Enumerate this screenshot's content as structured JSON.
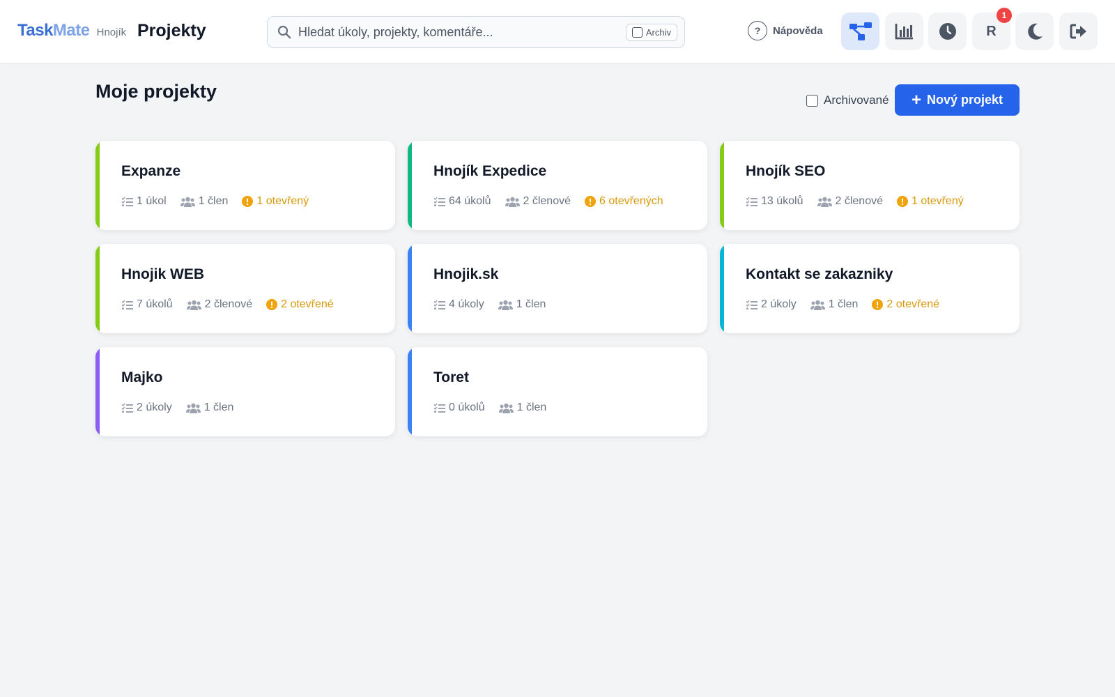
{
  "header": {
    "logo_part1": "Task",
    "logo_part2": "Mate",
    "workspace": "Hnojík",
    "title": "Projekty",
    "search_placeholder": "Hledat úkoly, projekty, komentáře...",
    "archive_chip": "Archiv",
    "help_label": "Nápověda",
    "help_icon_glyph": "?",
    "avatar_letter": "R",
    "notification_count": "1",
    "icons": [
      "project-tree-icon",
      "chart-bar-icon",
      "clock-icon",
      "avatar",
      "moon-icon",
      "logout-icon"
    ]
  },
  "main": {
    "section_title": "Moje projekty",
    "archived_label": "Archivované",
    "new_project_label": "Nový projekt",
    "new_project_icon": "+"
  },
  "projects": [
    {
      "name": "Expanze",
      "tasks": "1 úkol",
      "members": "1 člen",
      "open": "1 otevřený",
      "color": "#84cc16"
    },
    {
      "name": "Hnojík Expedice",
      "tasks": "64 úkolů",
      "members": "2 členové",
      "open": "6 otevřených",
      "color": "#10b981"
    },
    {
      "name": "Hnojík SEO",
      "tasks": "13 úkolů",
      "members": "2 členové",
      "open": "1 otevřený",
      "color": "#84cc16"
    },
    {
      "name": "Hnojik WEB",
      "tasks": "7 úkolů",
      "members": "2 členové",
      "open": "2 otevřené",
      "color": "#84cc16"
    },
    {
      "name": "Hnojik.sk",
      "tasks": "4 úkoly",
      "members": "1 člen",
      "open": "",
      "color": "#3b82f6"
    },
    {
      "name": "Kontakt se zakazniky",
      "tasks": "2 úkoly",
      "members": "1 člen",
      "open": "2 otevřené",
      "color": "#06b6d4"
    },
    {
      "name": "Majko",
      "tasks": "2 úkoly",
      "members": "1 člen",
      "open": "",
      "color": "#8b5cf6"
    },
    {
      "name": "Toret",
      "tasks": "0 úkolů",
      "members": "1 člen",
      "open": "",
      "color": "#3b82f6"
    }
  ],
  "colors": {
    "accent": "#2563eb",
    "warning": "#d99a0b",
    "badge": "#ef4444"
  }
}
